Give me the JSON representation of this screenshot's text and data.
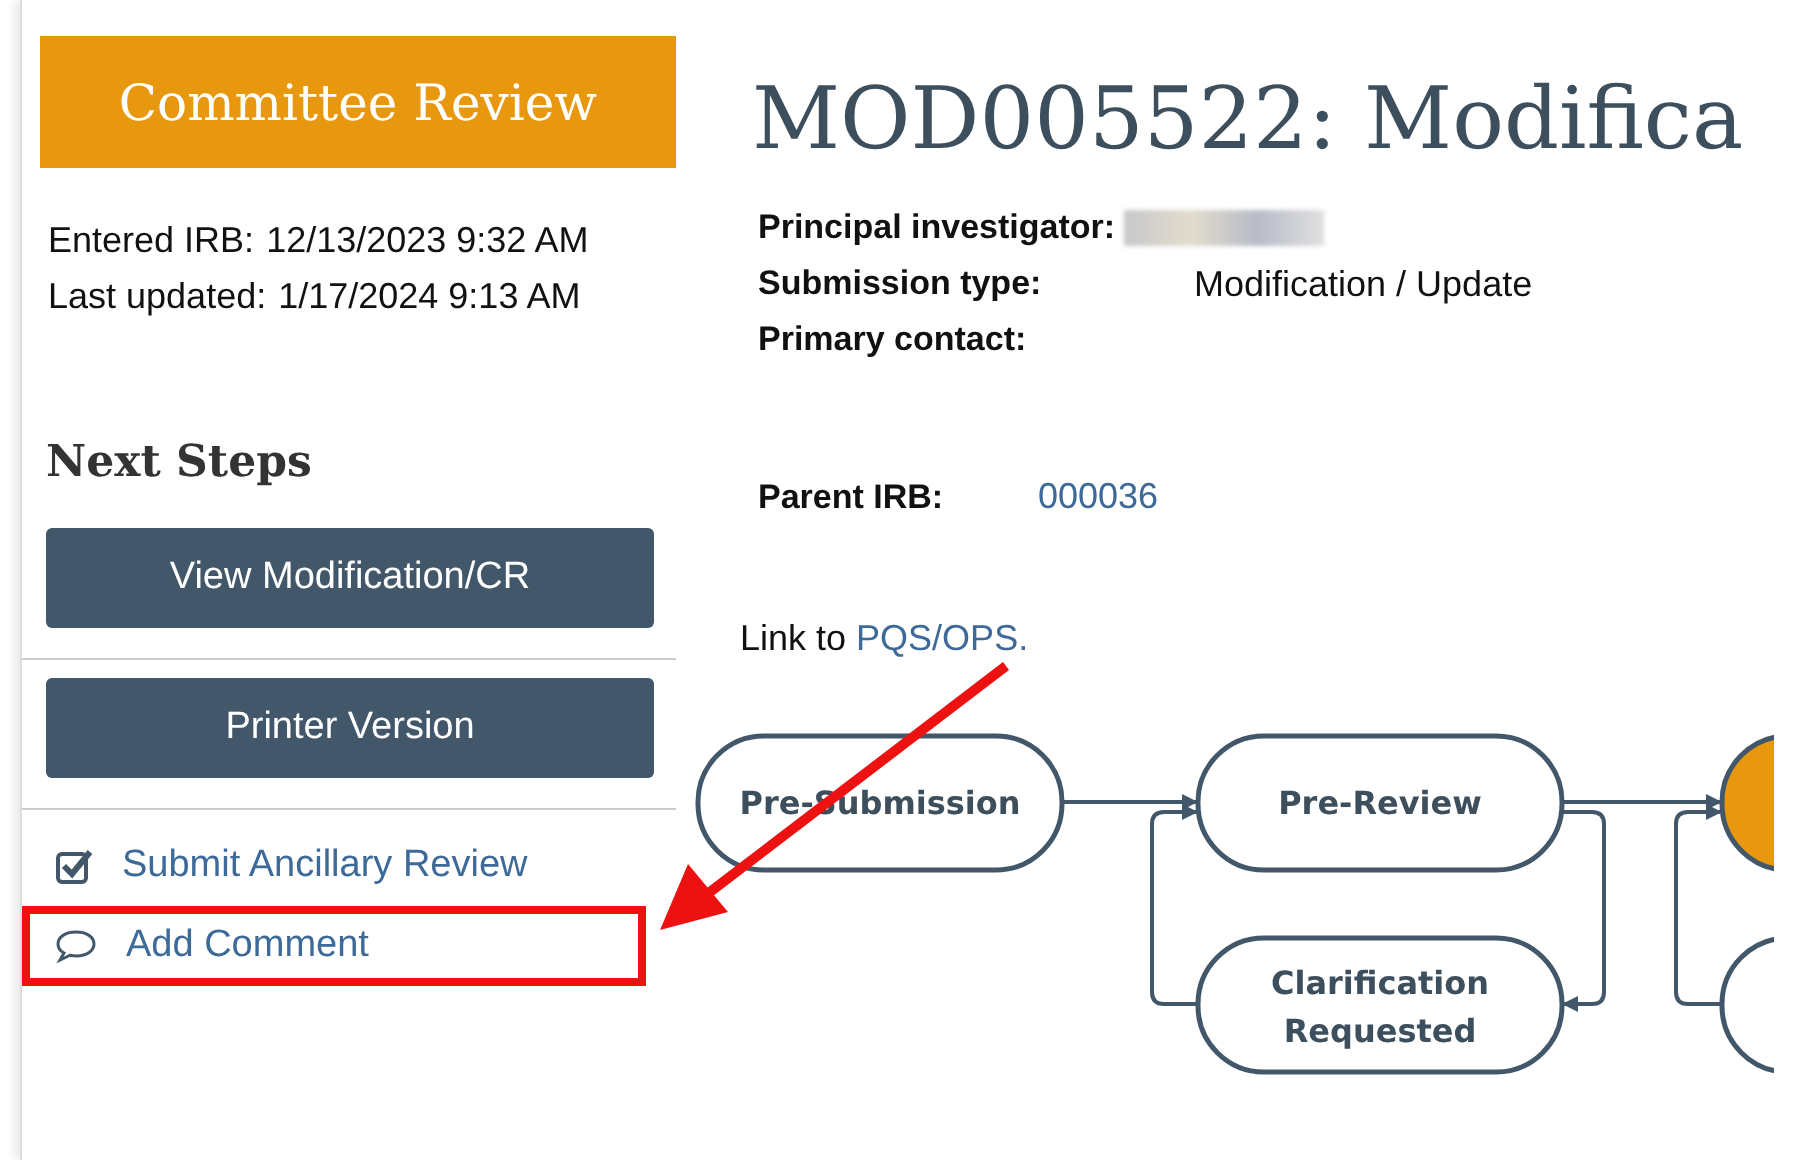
{
  "status_banner": "Committee Review",
  "dates": [
    {
      "label": "Entered IRB:",
      "value": "12/13/2023 9:32 AM"
    },
    {
      "label": "Last updated:",
      "value": "1/17/2024 9:13 AM"
    }
  ],
  "next_steps": {
    "heading": "Next Steps",
    "buttons": [
      "View Modification/CR",
      "Printer Version"
    ],
    "links": [
      {
        "kind": "check",
        "label": "Submit Ancillary Review",
        "highlighted": false
      },
      {
        "kind": "comment",
        "label": "Add Comment",
        "highlighted": true
      }
    ]
  },
  "title": "MOD005522: Modifica",
  "fields": [
    {
      "label": "Principal investigator:",
      "kind": "redacted"
    },
    {
      "label": "Submission type:",
      "value": "Modification / Update"
    },
    {
      "label": "Primary contact:"
    }
  ],
  "parent_irb": {
    "label": "Parent IRB:",
    "value": "000036"
  },
  "link_line": {
    "text": "Link to",
    "link": "PQS/OPS."
  },
  "workflow": {
    "nodes": [
      {
        "label": "Pre-Submission",
        "current": false
      },
      {
        "label": "Pre-Review",
        "current": false
      },
      {
        "label": "Clarification",
        "label2": "Requested",
        "current": false
      },
      {
        "current": true
      },
      {
        "current": false
      }
    ]
  }
}
